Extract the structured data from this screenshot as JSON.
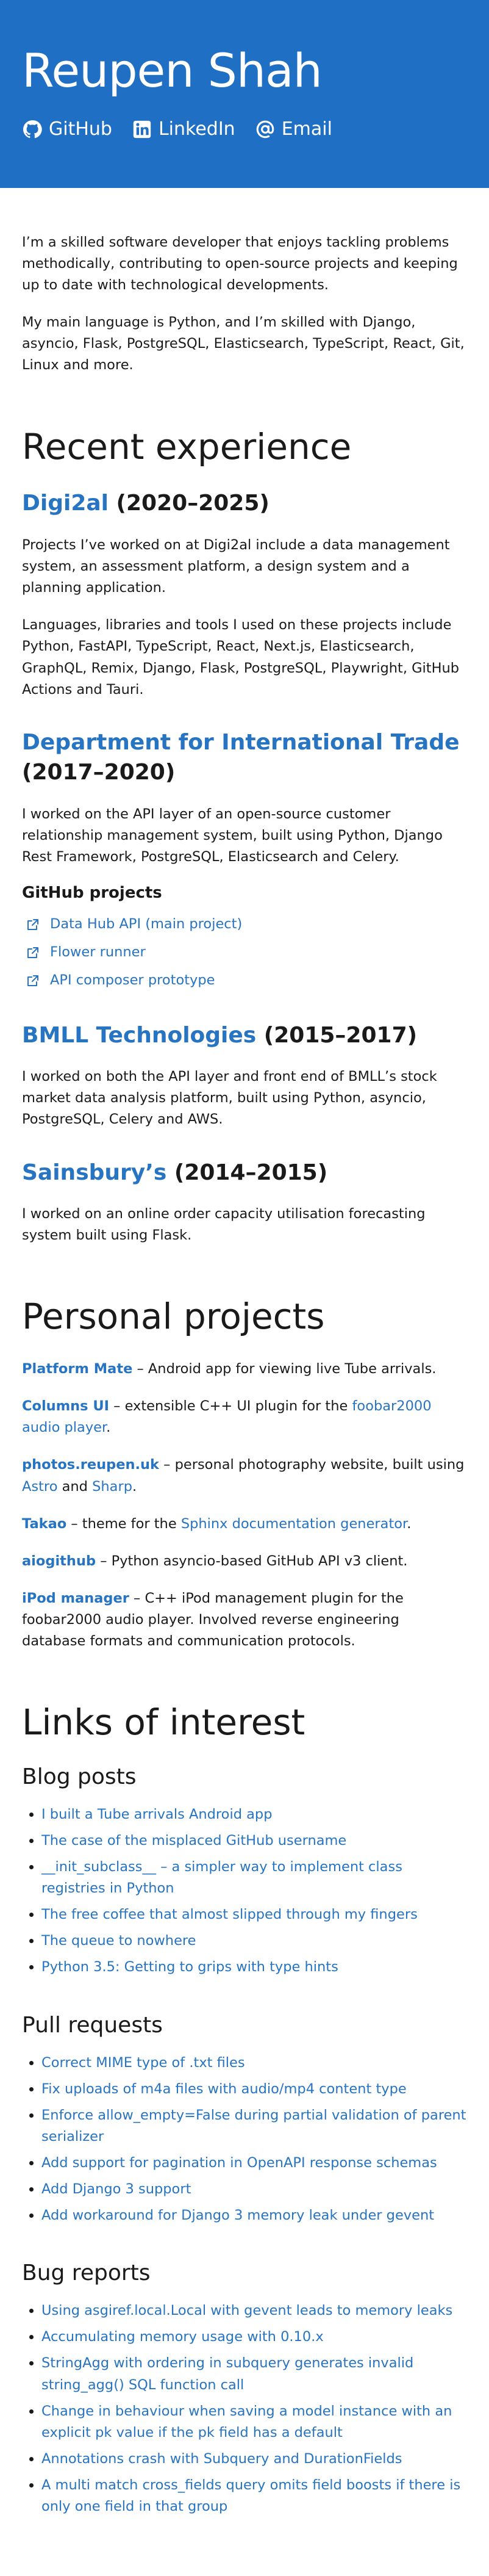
{
  "header": {
    "name": "Reupen Shah",
    "social": [
      {
        "label": "GitHub",
        "icon": "github-icon"
      },
      {
        "label": "LinkedIn",
        "icon": "linkedin-icon"
      },
      {
        "label": "Email",
        "icon": "at-icon"
      }
    ]
  },
  "intro": [
    "I’m a skilled software developer that enjoys tackling problems methodically, contributing to open-source projects and keeping up to date with technological developments.",
    "My main language is Python, and I’m skilled with Django, asyncio, Flask, PostgreSQL, Elasticsearch, TypeScript, React, Git, Linux and more."
  ],
  "experience": {
    "heading": "Recent experience",
    "items": [
      {
        "company": "Digi2al",
        "years": " (2020–2025)",
        "paragraphs": [
          "Projects I’ve worked on at Digi2al include a data management system, an assessment platform, a design system and a planning application.",
          "Languages, libraries and tools I used on these projects include Python, FastAPI, TypeScript, React, Next.js, Elasticsearch, GraphQL, Remix, Django, Flask, PostgreSQL, Playwright, GitHub Actions and Tauri."
        ]
      },
      {
        "company": "Department for International Trade",
        "years": " (2017–2020)",
        "paragraphs": [
          "I worked on the API layer of an open-source customer relationship management system, built using Python, Django Rest Framework, PostgreSQL, Elasticsearch and Celery."
        ],
        "github_title": "GitHub projects",
        "github_projects": [
          "Data Hub API (main project)",
          "Flower runner",
          "API composer prototype"
        ]
      },
      {
        "company": "BMLL Technologies",
        "years": " (2015–2017)",
        "paragraphs": [
          "I worked on both the API layer and front end of BMLL’s stock market data analysis platform, built using Python, asyncio, PostgreSQL, Celery and AWS."
        ]
      },
      {
        "company": "Sainsbury’s",
        "years": " (2014–2015)",
        "paragraphs": [
          "I worked on an online order capacity utilisation forecasting system built using Flask."
        ]
      }
    ]
  },
  "projects": {
    "heading": "Personal projects",
    "items": [
      {
        "name": "Platform Mate",
        "text": " – Android app for viewing live Tube arrivals."
      },
      {
        "name": "Columns UI",
        "text": " – extensible C++ UI plugin for the ",
        "link": "foobar2000 audio player",
        "tail": "."
      },
      {
        "name": "photos.reupen.uk",
        "text": " – personal photography website, built using ",
        "link": "Astro",
        "mid": " and ",
        "link2": "Sharp",
        "tail": "."
      },
      {
        "name": "Takao",
        "text": " – theme for the ",
        "link": "Sphinx documentation generator",
        "tail": "."
      },
      {
        "name": "aiogithub",
        "text": " – Python asyncio-based GitHub API v3 client."
      },
      {
        "name": "iPod manager",
        "text": " – C++ iPod management plugin for the foobar2000 audio player. Involved reverse engineering database formats and communication protocols."
      }
    ]
  },
  "links": {
    "heading": "Links of interest",
    "sections": [
      {
        "title": "Blog posts",
        "items": [
          "I built a Tube arrivals Android app",
          "The case of the misplaced GitHub username",
          "__init_subclass__ – a simpler way to implement class registries in Python",
          "The free coffee that almost slipped through my fingers",
          "The queue to nowhere",
          "Python 3.5: Getting to grips with type hints"
        ]
      },
      {
        "title": "Pull requests",
        "items": [
          "Correct MIME type of .txt files",
          "Fix uploads of m4a files with audio/mp4 content type",
          "Enforce allow_empty=False during partial validation of parent serializer",
          "Add support for pagination in OpenAPI response schemas",
          "Add Django 3 support",
          "Add workaround for Django 3 memory leak under gevent"
        ]
      },
      {
        "title": "Bug reports",
        "items": [
          "Using asgiref.local.Local with gevent leads to memory leaks",
          "Accumulating memory usage with 0.10.x",
          "StringAgg with ordering in subquery generates invalid string_agg() SQL function call",
          "Change in behaviour when saving a model instance with an explicit pk value if the pk field has a default",
          "Annotations crash with Subquery and DurationFields",
          "A multi match cross_fields query omits field boosts if there is only one field in that group"
        ]
      }
    ]
  }
}
